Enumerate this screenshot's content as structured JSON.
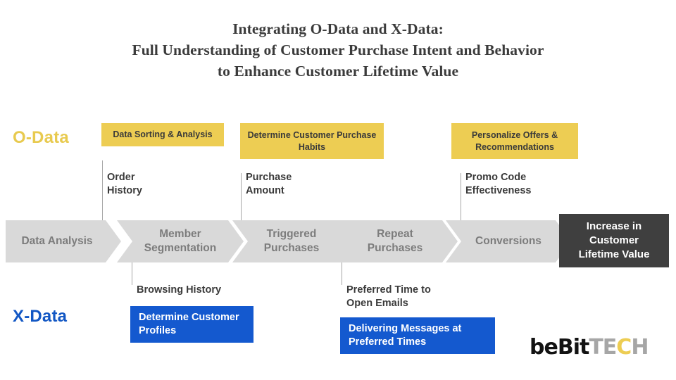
{
  "title": {
    "line1": "Integrating O-Data and X-Data:",
    "line2": "Full Understanding of Customer Purchase Intent and Behavior",
    "line3": "to Enhance Customer Lifetime Value"
  },
  "rows": {
    "odata_label": "O-Data",
    "xdata_label": "X-Data"
  },
  "colors": {
    "odata_yellow": "#edcd53",
    "odata_label": "#e8ca4f",
    "xdata_blue": "#1459cf",
    "xdata_label": "#1257c4",
    "chevron_gray": "#d9d9d9",
    "chevron_text": "#7c7c7c",
    "final_box": "#3f3f3f",
    "connector_line": "#a6a6a6",
    "title_text": "#3b3b3b",
    "metric_text": "#3a3a3a"
  },
  "odata": {
    "boxes": [
      {
        "label": "Data Sorting & Analysis"
      },
      {
        "label": "Determine Customer\nPurchase Habits"
      },
      {
        "label": "Personalize Offers &\nRecommendations"
      }
    ],
    "metrics": [
      {
        "label": "Order\nHistory"
      },
      {
        "label": "Purchase\nAmount"
      },
      {
        "label": "Promo Code\nEffectiveness"
      }
    ]
  },
  "xdata": {
    "metrics": [
      {
        "label": "Browsing History"
      },
      {
        "label": "Preferred Time to\nOpen Emails"
      }
    ],
    "boxes": [
      {
        "label": "Determine\nCustomer Profiles"
      },
      {
        "label": "Delivering Messages at\nPreferred Times"
      }
    ]
  },
  "flow": {
    "stages": [
      {
        "label": "Data Analysis"
      },
      {
        "label": "Member\nSegmentation"
      },
      {
        "label": "Triggered\nPurchases"
      },
      {
        "label": "Repeat\nPurchases"
      },
      {
        "label": "Conversions"
      }
    ],
    "outcome": {
      "label": "Increase in\nCustomer\nLifetime Value"
    }
  },
  "logo": {
    "part1": "beBit",
    "part2": "TE",
    "part3": "C",
    "part4": "H"
  }
}
